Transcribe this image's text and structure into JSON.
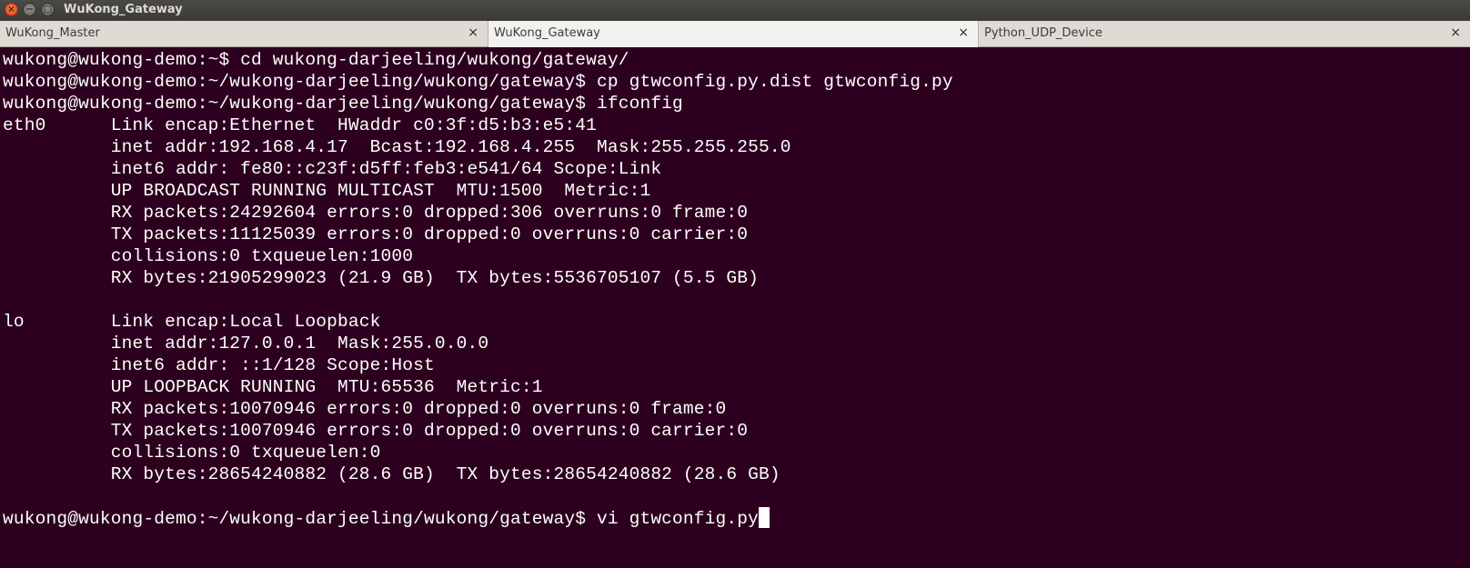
{
  "window": {
    "title": "WuKong_Gateway"
  },
  "titlebar_buttons": {
    "close_glyph": "×",
    "minimize_glyph": "−",
    "maximize_glyph": "□"
  },
  "tabs": [
    {
      "label": "WuKong_Master",
      "close": "×",
      "active": false
    },
    {
      "label": "WuKong_Gateway",
      "close": "×",
      "active": true
    },
    {
      "label": "Python_UDP_Device",
      "close": "×",
      "active": false
    }
  ],
  "terminal": {
    "background": "#2c001e",
    "foreground": "#ffffff",
    "lines": [
      "wukong@wukong-demo:~$ cd wukong-darjeeling/wukong/gateway/",
      "wukong@wukong-demo:~/wukong-darjeeling/wukong/gateway$ cp gtwconfig.py.dist gtwconfig.py",
      "wukong@wukong-demo:~/wukong-darjeeling/wukong/gateway$ ifconfig",
      "eth0      Link encap:Ethernet  HWaddr c0:3f:d5:b3:e5:41",
      "          inet addr:192.168.4.17  Bcast:192.168.4.255  Mask:255.255.255.0",
      "          inet6 addr: fe80::c23f:d5ff:feb3:e541/64 Scope:Link",
      "          UP BROADCAST RUNNING MULTICAST  MTU:1500  Metric:1",
      "          RX packets:24292604 errors:0 dropped:306 overruns:0 frame:0",
      "          TX packets:11125039 errors:0 dropped:0 overruns:0 carrier:0",
      "          collisions:0 txqueuelen:1000",
      "          RX bytes:21905299023 (21.9 GB)  TX bytes:5536705107 (5.5 GB)",
      "",
      "lo        Link encap:Local Loopback",
      "          inet addr:127.0.0.1  Mask:255.0.0.0",
      "          inet6 addr: ::1/128 Scope:Host",
      "          UP LOOPBACK RUNNING  MTU:65536  Metric:1",
      "          RX packets:10070946 errors:0 dropped:0 overruns:0 frame:0",
      "          TX packets:10070946 errors:0 dropped:0 overruns:0 carrier:0",
      "          collisions:0 txqueuelen:0",
      "          RX bytes:28654240882 (28.6 GB)  TX bytes:28654240882 (28.6 GB)",
      "",
      "wukong@wukong-demo:~/wukong-darjeeling/wukong/gateway$ vi gtwconfig.py"
    ]
  }
}
